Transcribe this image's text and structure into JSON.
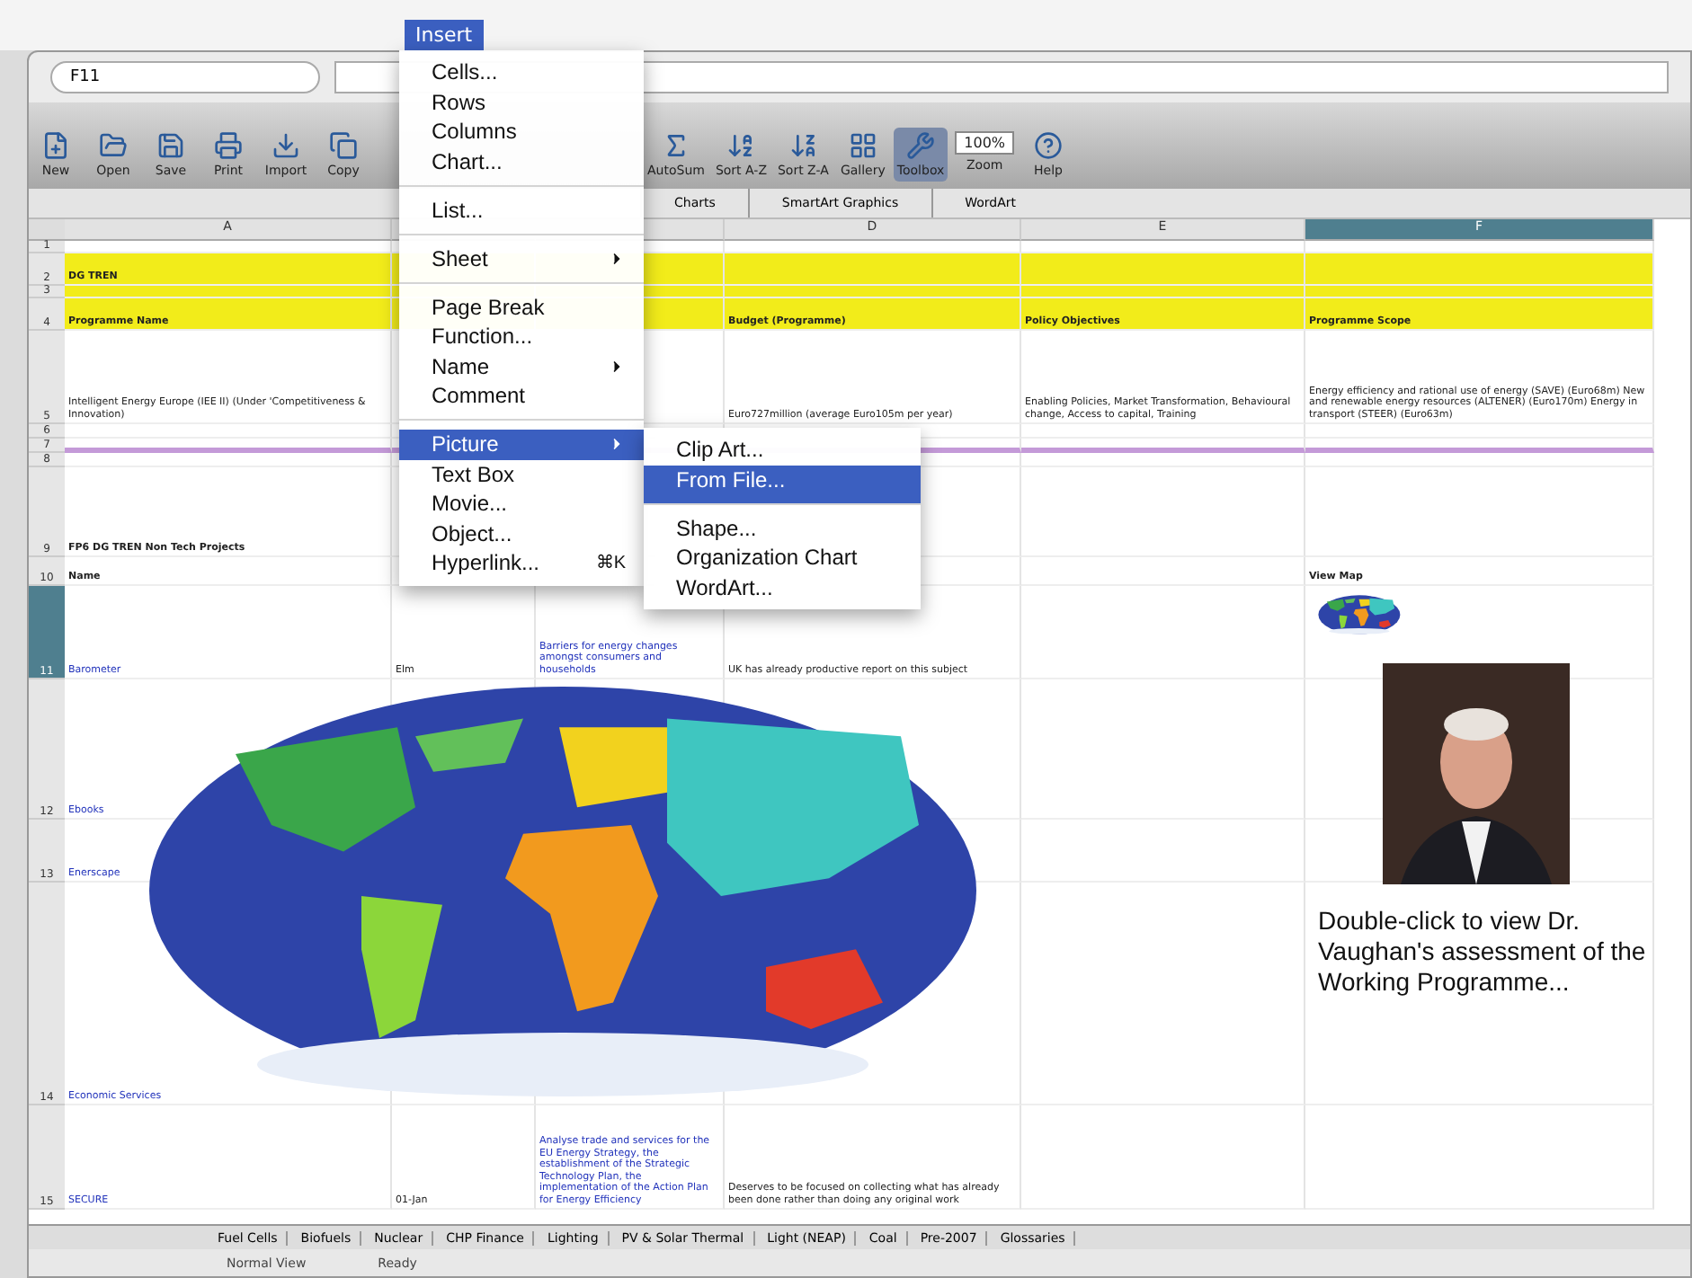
{
  "menu_bar": {
    "title": "Insert",
    "selected": true
  },
  "formula_bar": {
    "cell_ref": "F11"
  },
  "toolbar_left": [
    {
      "label": "New",
      "selected": false
    },
    {
      "label": "Open",
      "selected": false
    },
    {
      "label": "Save",
      "selected": false
    },
    {
      "label": "Print",
      "selected": false
    },
    {
      "label": "Import",
      "selected": false
    },
    {
      "label": "Copy",
      "selected": false
    }
  ],
  "toolbar_right": [
    {
      "label": "AutoSum",
      "selected": false
    },
    {
      "label": "Sort A-Z",
      "selected": false
    },
    {
      "label": "Sort Z-A",
      "selected": false
    },
    {
      "label": "Gallery",
      "selected": false
    },
    {
      "label": "Toolbox",
      "selected": true
    },
    {
      "label": "Zoom",
      "selected": false,
      "value": "100%"
    },
    {
      "label": "Help",
      "selected": false
    }
  ],
  "ribbon_tabs": [
    "Charts",
    "SmartArt Graphics",
    "WordArt"
  ],
  "columns": [
    {
      "label": "A",
      "selected": false
    },
    {
      "label": "D",
      "selected": false
    },
    {
      "label": "E",
      "selected": false
    },
    {
      "label": "F",
      "selected": true
    }
  ],
  "rows": [
    {
      "number": "1",
      "kind": "plain",
      "selected": false
    },
    {
      "number": "2",
      "kind": "header",
      "selected": false,
      "cells": {
        "a": "DG TREN"
      }
    },
    {
      "number": "3",
      "kind": "header",
      "selected": false
    },
    {
      "number": "4",
      "kind": "header",
      "selected": false,
      "cells": {
        "a": "Programme Name",
        "d": "Budget (Programme)",
        "e": "Policy Objectives",
        "f": "Programme Scope"
      }
    },
    {
      "number": "5",
      "kind": "plain",
      "selected": false,
      "cells": {
        "a": "Intelligent Energy Europe (IEE II) (Under 'Competitiveness & Innovation)",
        "d": "Euro727million (average Euro105m per year)",
        "e": "Enabling Policies, Market Transformation, Behavioural change, Access to capital, Training",
        "f": "Energy efficiency and rational use of energy (SAVE) (Euro68m) New and renewable energy resources (ALTENER) (Euro170m) Energy in transport (STEER) (Euro63m)"
      }
    },
    {
      "number": "6",
      "kind": "plain",
      "selected": false
    },
    {
      "number": "7",
      "kind": "divider",
      "selected": false
    },
    {
      "number": "8",
      "kind": "plain",
      "selected": false
    },
    {
      "number": "9",
      "kind": "plain",
      "selected": false,
      "cells": {
        "a": "FP6 DG TREN Non Tech Projects"
      }
    },
    {
      "number": "10",
      "kind": "plain",
      "selected": false,
      "cells": {
        "a": "Name",
        "f": "View Map"
      }
    },
    {
      "number": "11",
      "kind": "plain",
      "selected": true,
      "cells": {
        "a": "Barometer",
        "b": "Elm",
        "c": "Barriers for energy changes amongst consumers and households",
        "d": "UK has already productive report on this subject"
      }
    },
    {
      "number": "12",
      "kind": "plain",
      "selected": false,
      "cells": {
        "a": "Ebooks"
      }
    },
    {
      "number": "13",
      "kind": "plain",
      "selected": false,
      "cells": {
        "a": "Enerscape"
      }
    },
    {
      "number": "14",
      "kind": "plain",
      "selected": false,
      "cells": {
        "a": "Economic Services"
      }
    },
    {
      "number": "15",
      "kind": "plain",
      "selected": false,
      "cells": {
        "a": "SECURE",
        "b": "01-Jan",
        "c": "Analyse trade and services for the EU Energy Strategy, the establishment of the Strategic Technology Plan, the implementation of the Action Plan for Energy Efficiency",
        "d": "Deserves to be focused on collecting what has already been done rather than doing any original work"
      }
    }
  ],
  "portrait": {
    "caption": "Double-click to view Dr. Vaughan's assessment of the Working Programme..."
  },
  "insert_menu": [
    {
      "label": "Cells...",
      "submenu": false,
      "selected": false,
      "separator_after": false
    },
    {
      "label": "Rows",
      "submenu": false,
      "selected": false,
      "separator_after": false
    },
    {
      "label": "Columns",
      "submenu": false,
      "selected": false,
      "separator_after": false
    },
    {
      "label": "Chart...",
      "submenu": false,
      "selected": false,
      "separator_after": true
    },
    {
      "label": "List...",
      "submenu": false,
      "selected": false,
      "separator_after": true
    },
    {
      "label": "Sheet",
      "submenu": true,
      "selected": false,
      "separator_after": true
    },
    {
      "label": "Page Break",
      "submenu": false,
      "selected": false,
      "separator_after": false
    },
    {
      "label": "Function...",
      "submenu": false,
      "selected": false,
      "separator_after": false
    },
    {
      "label": "Name",
      "submenu": true,
      "selected": false,
      "separator_after": false
    },
    {
      "label": "Comment",
      "submenu": false,
      "selected": false,
      "separator_after": true
    },
    {
      "label": "Picture",
      "submenu": true,
      "selected": true,
      "separator_after": false
    },
    {
      "label": "Text Box",
      "submenu": false,
      "selected": false,
      "separator_after": false
    },
    {
      "label": "Movie...",
      "submenu": false,
      "selected": false,
      "separator_after": false
    },
    {
      "label": "Object...",
      "submenu": false,
      "selected": false,
      "separator_after": false
    },
    {
      "label": "Hyperlink...",
      "submenu": false,
      "selected": false,
      "separator_after": false,
      "shortcut": "⌘K"
    }
  ],
  "picture_submenu": [
    {
      "label": "Clip Art...",
      "selected": false,
      "separator_after": false
    },
    {
      "label": "From File...",
      "selected": true,
      "separator_after": true
    },
    {
      "label": "Shape...",
      "selected": false,
      "separator_after": false
    },
    {
      "label": "Organization Chart",
      "selected": false,
      "separator_after": false
    },
    {
      "label": "WordArt...",
      "selected": false,
      "separator_after": false
    }
  ],
  "sheet_tabs": [
    "Fuel Cells",
    "Biofuels",
    "Nuclear",
    "CHP Finance",
    "Lighting",
    "PV & Solar Thermal",
    "Light (NEAP)",
    "Coal",
    "Pre-2007",
    "Glossaries"
  ],
  "status_bar": {
    "view": "Normal View",
    "state": "Ready"
  }
}
